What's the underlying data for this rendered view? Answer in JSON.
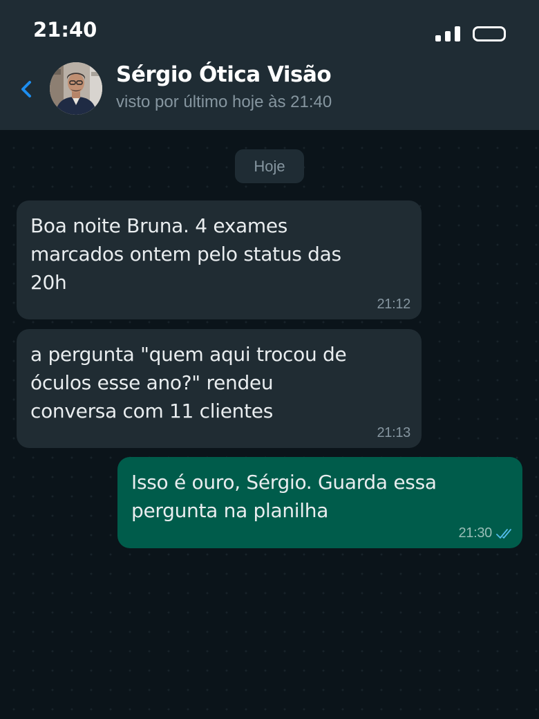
{
  "status_bar": {
    "time": "21:40",
    "signal_icon": "signal-bars-icon",
    "battery_icon": "battery-icon"
  },
  "header": {
    "back_icon": "chevron-left-icon",
    "contact_name": "Sérgio Ótica Visão",
    "last_seen": "visto por último hoje às 21:40"
  },
  "chat": {
    "date_separator": "Hoje",
    "messages": [
      {
        "direction": "incoming",
        "text": "Boa noite Bruna. 4 exames\nmarcados ontem pelo status das\n20h",
        "time": "21:12"
      },
      {
        "direction": "incoming",
        "text": "a pergunta \"quem aqui trocou de\nóculos esse ano?\" rendeu\nconversa com 11 clientes",
        "time": "21:13"
      },
      {
        "direction": "outgoing",
        "text": "Isso é ouro, Sérgio. Guarda essa\npergunta na planilha",
        "time": "21:30",
        "status_icon": "double-check-read-icon"
      }
    ]
  },
  "colors": {
    "background": "#0b141a",
    "header": "#1f2c34",
    "incoming_bubble": "#202c33",
    "outgoing_bubble": "#005c4b",
    "accent": "#1d8ef0",
    "read_ticks": "#53bdeb"
  }
}
